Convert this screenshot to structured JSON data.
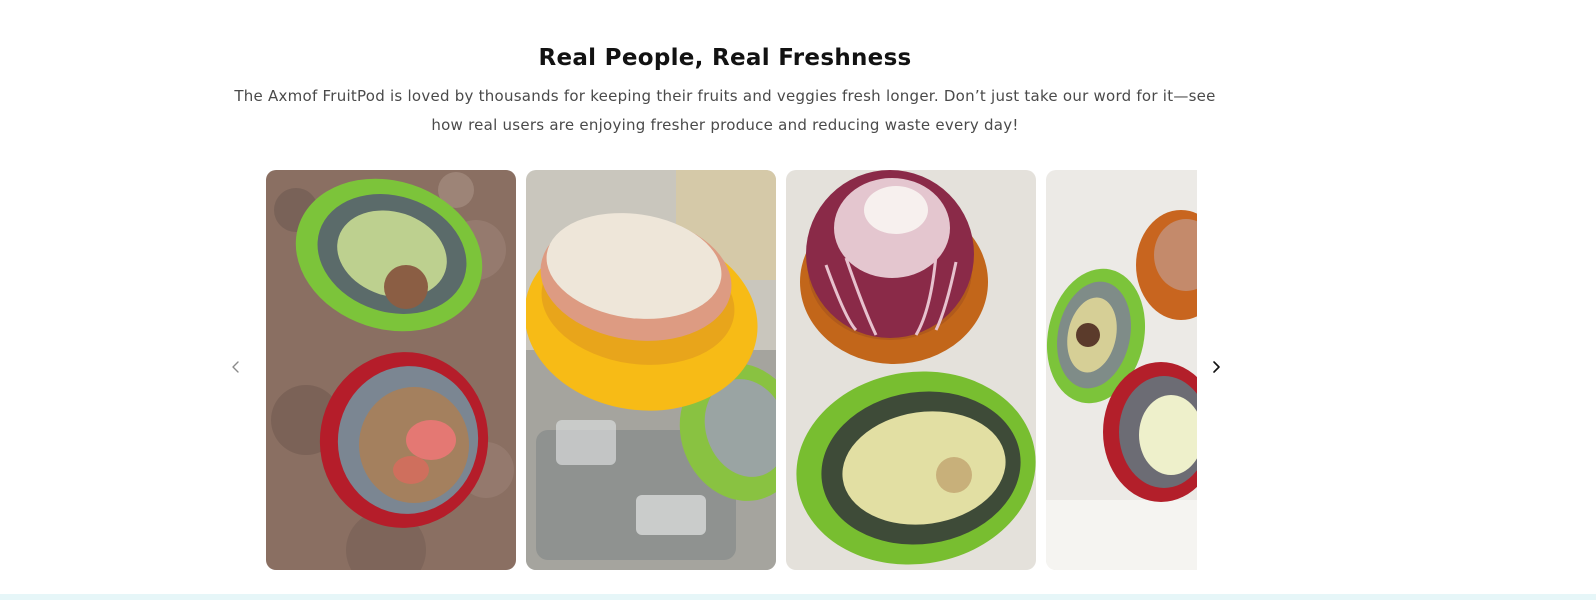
{
  "section": {
    "title": "Real People, Real Freshness",
    "description": "The Axmof FruitPod is loved by thousands for keeping their fruits and veggies fresh longer. Don’t just take our word for it—see how real users are enjoying fresher produce and reducing waste every day!"
  },
  "carousel": {
    "prev_icon": "chevron-left-icon",
    "next_icon": "chevron-right-icon",
    "slides": [
      {
        "icon": "avocado-and-tomato-pods-photo"
      },
      {
        "icon": "onion-in-yellow-pod-photo"
      },
      {
        "icon": "red-onion-and-avocado-pods-photo"
      },
      {
        "icon": "avocado-tomato-onion-pods-photo"
      }
    ]
  },
  "colors": {
    "heading": "#121212",
    "body_text": "#4a4a4a",
    "pod_green": "#7cc43a",
    "pod_red": "#b51d2a",
    "pod_yellow": "#f7bb16",
    "pod_orange": "#c2661a",
    "bottom_strip": "#e6f6f8"
  }
}
